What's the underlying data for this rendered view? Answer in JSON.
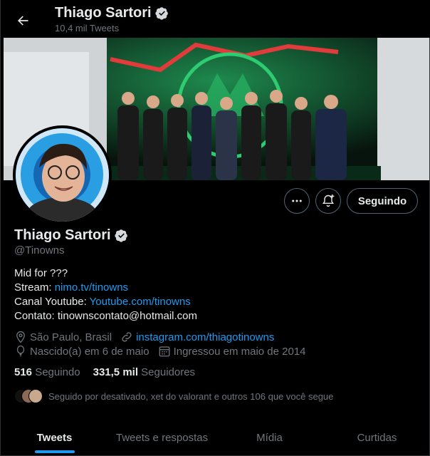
{
  "header": {
    "name": "Thiago Sartori",
    "tweet_count": "10,4 mil Tweets"
  },
  "profile": {
    "display_name": "Thiago Sartori",
    "handle": "@Tinowns",
    "follow_button": "Seguindo",
    "bio": {
      "line1": "Mid for ???",
      "stream_label": "Stream: ",
      "stream_link": "nimo.tv/tinowns",
      "youtube_label": "Canal Youtube: ",
      "youtube_link": "Youtube.com/tinowns",
      "contact": "Contato: tinownscontato@hotmail.com"
    },
    "location": "São Paulo, Brasil",
    "website": "instagram.com/thiagotinowns",
    "birthday": "Nascido(a) em 6 de maio",
    "joined": "Ingressou em maio de 2014",
    "following_count": "516",
    "following_label": "Seguindo",
    "followers_count": "331,5 mil",
    "followers_label": "Seguidores",
    "followed_by": "Seguido por desativado, xet do valorant e outros 106 que você segue"
  },
  "tabs": [
    {
      "label": "Tweets",
      "active": true
    },
    {
      "label": "Tweets e respostas",
      "active": false
    },
    {
      "label": "Mídia",
      "active": false
    },
    {
      "label": "Curtidas",
      "active": false
    }
  ],
  "colors": {
    "accent": "#1d9bf0",
    "background": "#000000",
    "muted": "#71767b"
  }
}
